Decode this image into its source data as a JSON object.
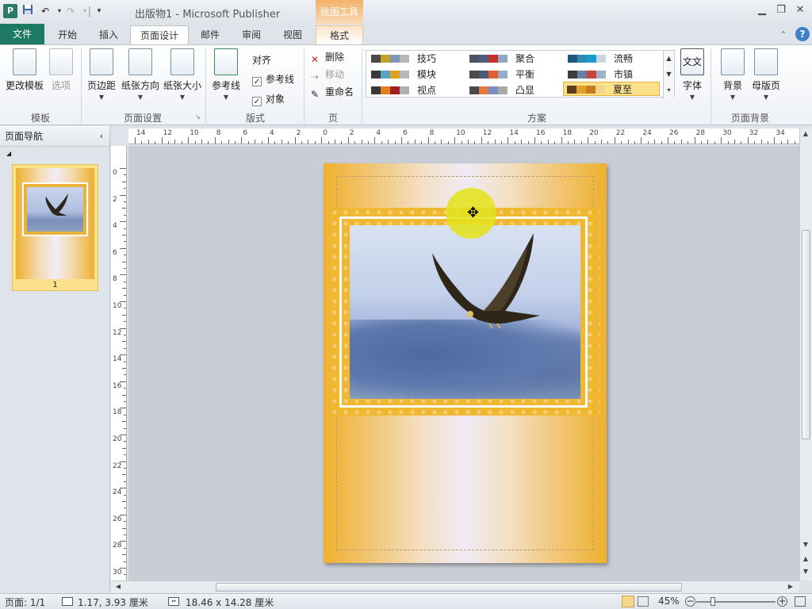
{
  "titlebar": {
    "title": "出版物1 - Microsoft Publisher",
    "context_tab_group": "绘图工具",
    "app_icon_letter": "P",
    "help_glyph": "?"
  },
  "tabs": {
    "file": "文件",
    "home": "开始",
    "insert": "插入",
    "page_design": "页面设计",
    "mailings": "邮件",
    "review": "审阅",
    "view": "视图",
    "format": "格式"
  },
  "ribbon": {
    "template_group": {
      "label": "模板",
      "change_template": "更改模板",
      "options": "选项"
    },
    "page_setup_group": {
      "label": "页面设置",
      "margins": "页边距",
      "orientation": "纸张方向",
      "size": "纸张大小"
    },
    "layout_group": {
      "label": "版式",
      "guides": "参考线",
      "align_label": "对齐",
      "align_guides": "参考线",
      "align_objects": "对象",
      "guides_checked": true,
      "objects_checked": true
    },
    "pages_group": {
      "label": "页",
      "delete": "删除",
      "move": "移动",
      "rename": "重命名"
    },
    "schemes_group": {
      "label": "方案",
      "schemes": [
        {
          "name": "技巧",
          "colors": [
            "#4a4a4a",
            "#c6a328",
            "#7f96b5",
            "#b7b7b7"
          ]
        },
        {
          "name": "聚合",
          "colors": [
            "#4b5565",
            "#4e5e7a",
            "#c5302d",
            "#8fa7c5"
          ]
        },
        {
          "name": "流畅",
          "colors": [
            "#1b5a7a",
            "#2b8bb0",
            "#1a9bd0",
            "#c9d6e2"
          ]
        },
        {
          "name": "模块",
          "colors": [
            "#3a3a3a",
            "#5aa0c8",
            "#e0a020",
            "#b8b8b8"
          ]
        },
        {
          "name": "平衡",
          "colors": [
            "#4a4a4a",
            "#4c5b7a",
            "#e06030",
            "#9aaccc"
          ]
        },
        {
          "name": "市镇",
          "colors": [
            "#3c3c3c",
            "#6a7fa8",
            "#c8443c",
            "#9fb2c8"
          ]
        },
        {
          "name": "视点",
          "colors": [
            "#3a3a3a",
            "#e08020",
            "#a02020",
            "#b0b0b0"
          ]
        },
        {
          "name": "凸显",
          "colors": [
            "#4a4a4a",
            "#e07a40",
            "#7a8fc0",
            "#a8a8a8"
          ]
        },
        {
          "name": "夏至",
          "colors": [
            "#5a3a20",
            "#e3a02a",
            "#c97c1a",
            "#f2d58a"
          ],
          "selected": true
        }
      ]
    },
    "fonts_group": {
      "fonts": "字体",
      "fonts_icon_text": "文文"
    },
    "page_background_group": {
      "label": "页面背景",
      "background": "背景",
      "master_page": "母版页"
    }
  },
  "nav_pane": {
    "title": "页面导航",
    "collapse_glyph": "‹",
    "page_number": "1"
  },
  "rulers": {
    "horizontal": [
      "14",
      "12",
      "10",
      "8",
      "6",
      "4",
      "2",
      "0",
      "2",
      "4",
      "6",
      "8",
      "10",
      "12",
      "14",
      "16",
      "18",
      "20",
      "22",
      "24",
      "26",
      "28",
      "30",
      "32",
      "34"
    ],
    "vertical": [
      "0",
      "2",
      "4",
      "6",
      "8",
      "10",
      "12",
      "14",
      "16",
      "18",
      "20",
      "22",
      "24",
      "26",
      "28",
      "30"
    ]
  },
  "statusbar": {
    "page": "页面: 1/1",
    "position": "1.17, 3.93 厘米",
    "size": "18.46 x 14.28 厘米",
    "zoom": "45%"
  }
}
